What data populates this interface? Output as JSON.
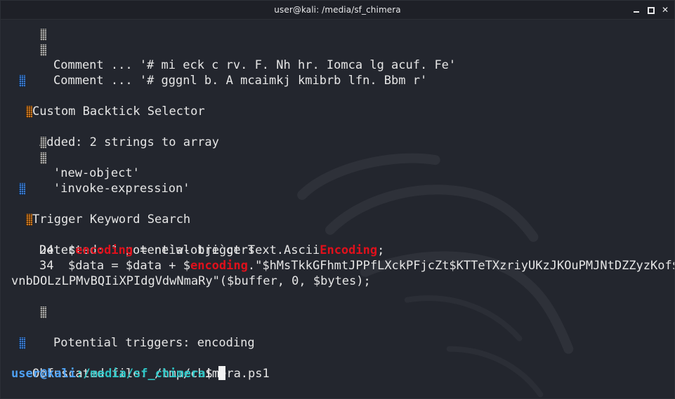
{
  "window": {
    "title": "user@kali: /media/sf_chimera",
    "controls": [
      "minimize",
      "maximize",
      "close"
    ],
    "close_glyph": "✕"
  },
  "colors": {
    "background": "#23262e",
    "text": "#e6e6e6",
    "highlight_red": "#e0101b",
    "bullet_gray": "#a9a9a9",
    "bullet_blue": "#3b7bd0",
    "bullet_orange": "#d07a22",
    "prompt_user": "#4ea1f3",
    "prompt_path": "#2ec5c5"
  },
  "terminal": {
    "comments": [
      "Comment ... '# mi eck c rv. F. Nh hr. Iomca lg acuf. Fe'",
      "Comment ... '# gggnl b. A mcaimkj kmibrb lfn. Bbm r'"
    ],
    "section_backtick": "Custom Backtick Selector",
    "added_strings": "Added: 2 strings to array",
    "array_items": [
      "'new-object'",
      "'invoke-expression'"
    ],
    "section_trigger": "Trigger Keyword Search",
    "detected": "Detected: 1 potential triggers",
    "code_24": {
      "lineno": "24",
      "pre": "$",
      "kw1": "encoding",
      "mid": " = ne`w-obje`ct Text.Ascii",
      "kw2": "Encoding",
      "post": ";"
    },
    "code_34": {
      "lineno": "34",
      "pre": "$data = $data + $",
      "kw1": "encoding",
      "post": ".\"$hMsTkkGFhmtJPPfLXckPFjcZt$KTTeTXzriyUKzJKOuPMJNtDZZyzKof$",
      "wrap": "vnbDOLzLPMvBQIiXPIdgVdwNmaRy\"($buffer, 0, $bytes);"
    },
    "potential_triggers": "Potential triggers: encoding",
    "obfuscated_file": "Obfuscated file: /tmp/chimera.ps1",
    "prompt": {
      "user": "user@kali",
      "path": ":/media/sf_chimera",
      "symbol": "$"
    }
  }
}
